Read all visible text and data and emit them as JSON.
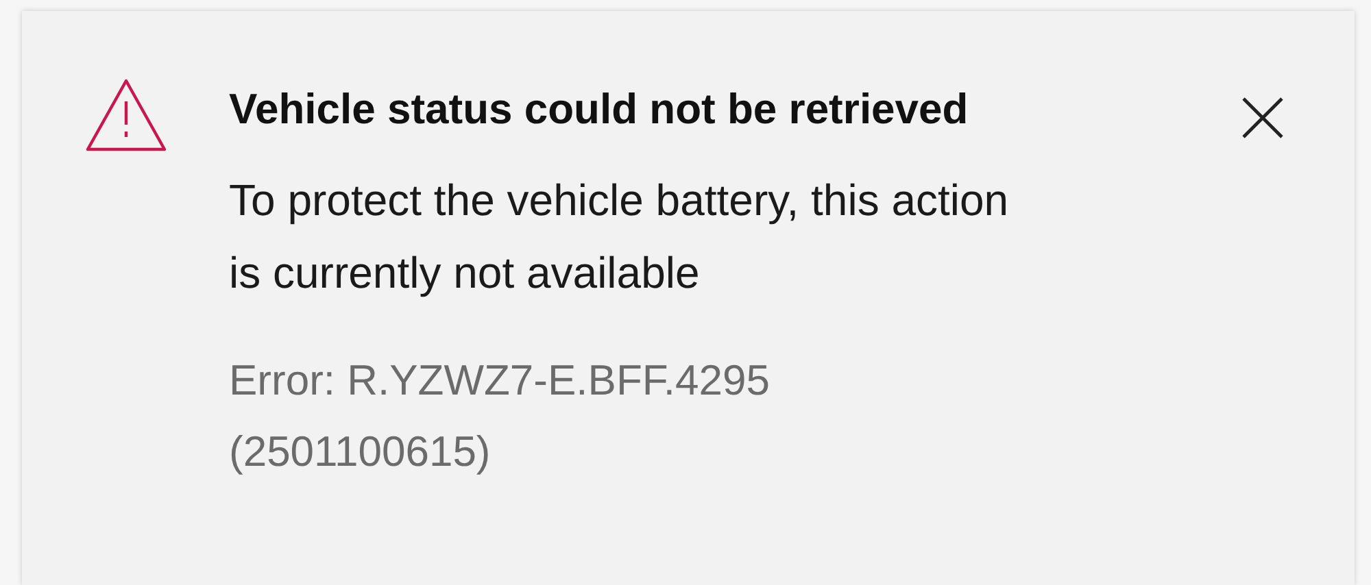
{
  "dialog": {
    "title": "Vehicle status could not be retrieved",
    "message": [
      "To protect the vehicle battery, this action",
      "is currently not available"
    ],
    "error": [
      "Error: R.YZWZ7-E.BFF.4295",
      "(2501100615)"
    ]
  }
}
